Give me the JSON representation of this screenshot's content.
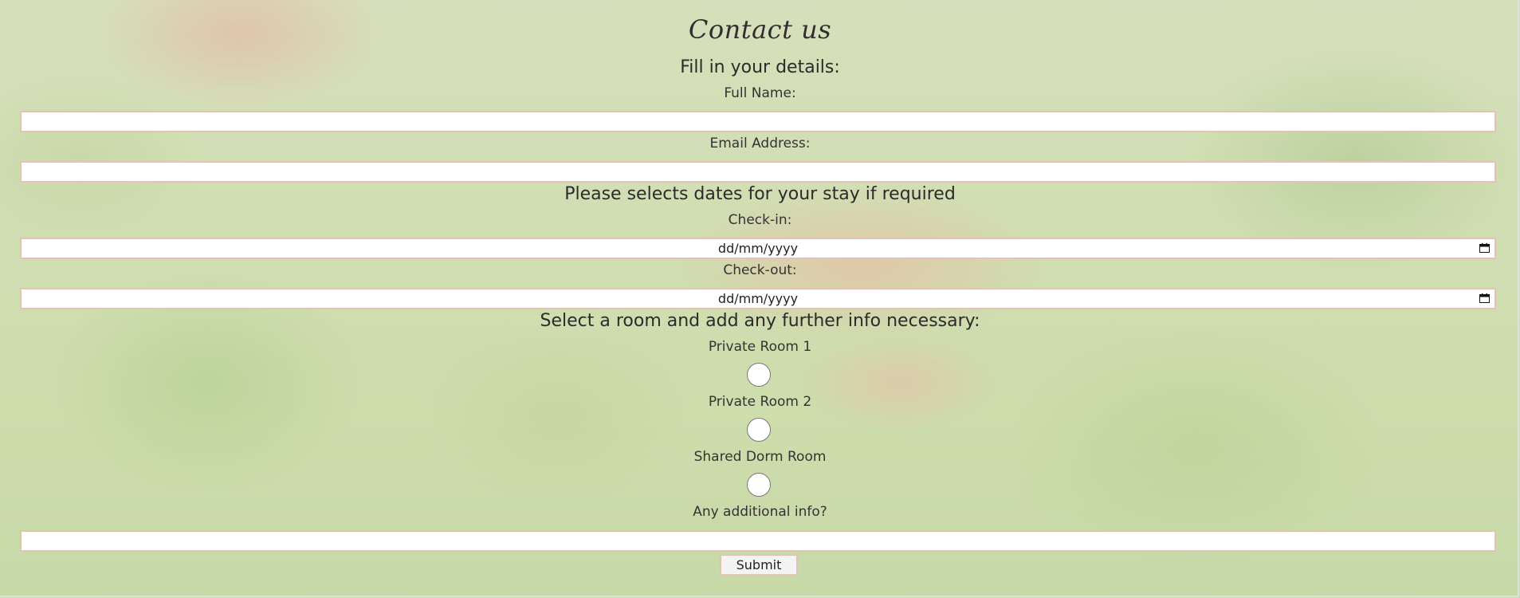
{
  "form": {
    "title": "Contact us",
    "details_heading": "Fill in your details:",
    "full_name_label": "Full Name:",
    "full_name_value": "",
    "email_label": "Email Address:",
    "email_value": "",
    "dates_heading": "Please selects dates for your stay if required",
    "checkin_label": "Check-in:",
    "checkin_value": "dd/mm/yyyy",
    "checkout_label": "Check-out:",
    "checkout_value": "dd/mm/yyyy",
    "room_heading": "Select a room and add any further info necessary:",
    "rooms": [
      {
        "label": "Private Room 1",
        "selected": false
      },
      {
        "label": "Private Room 2",
        "selected": false
      },
      {
        "label": "Shared Dorm Room",
        "selected": false
      }
    ],
    "additional_label": "Any additional info?",
    "additional_value": "",
    "submit_label": "Submit"
  },
  "colors": {
    "field_border": "#e3c3b3",
    "text": "#2b2b2b"
  },
  "icons": {
    "calendar": "calendar-icon"
  }
}
